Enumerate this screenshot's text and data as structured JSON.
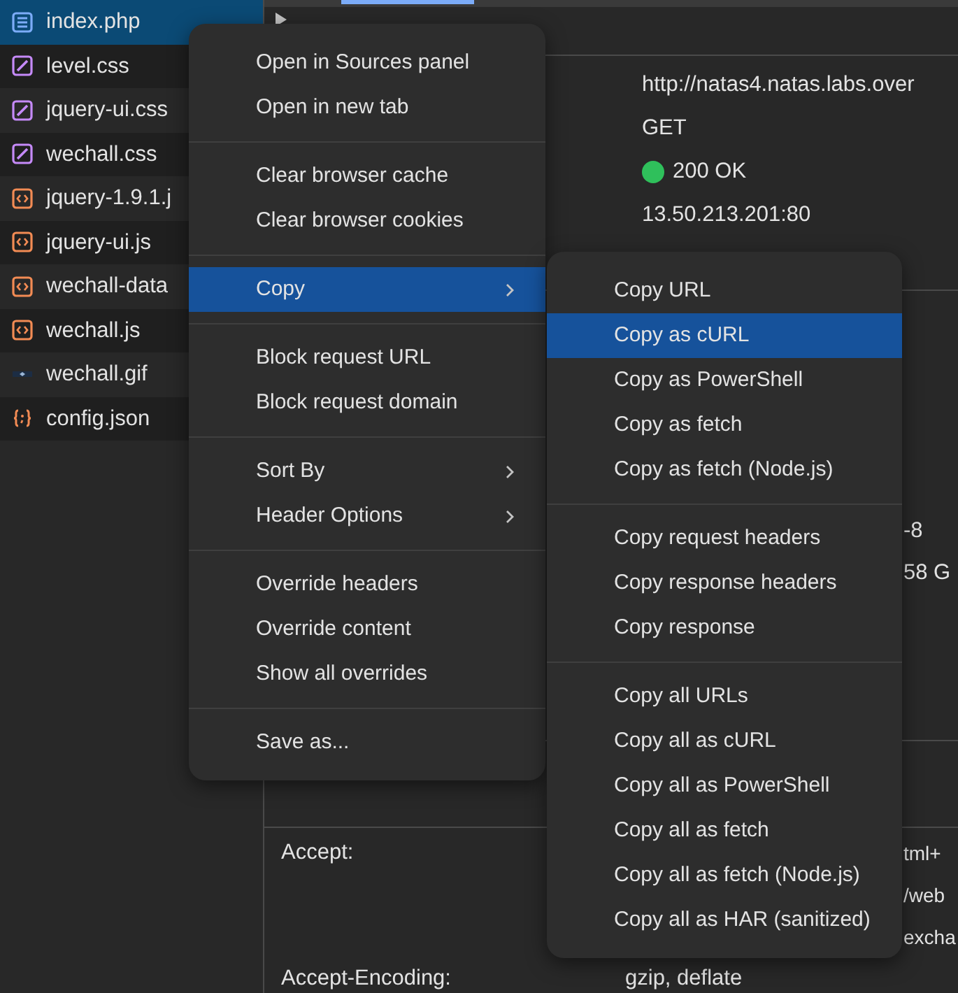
{
  "files": [
    {
      "name": "index.php",
      "kind": "document",
      "selected": true
    },
    {
      "name": "level.css",
      "kind": "stylesheet",
      "selected": false
    },
    {
      "name": "jquery-ui.css",
      "kind": "stylesheet",
      "selected": false
    },
    {
      "name": "wechall.css",
      "kind": "stylesheet",
      "selected": false
    },
    {
      "name": "jquery-1.9.1.j",
      "kind": "script",
      "selected": false
    },
    {
      "name": "jquery-ui.js",
      "kind": "script",
      "selected": false
    },
    {
      "name": "wechall-data",
      "kind": "script",
      "selected": false
    },
    {
      "name": "wechall.js",
      "kind": "script",
      "selected": false
    },
    {
      "name": "wechall.gif",
      "kind": "image",
      "selected": false
    },
    {
      "name": "config.json",
      "kind": "json",
      "selected": false
    }
  ],
  "general": {
    "rows": [
      {
        "value": "http://natas4.natas.labs.over"
      },
      {
        "value": "GET"
      },
      {
        "value": "200 OK",
        "color": "#2fc05b"
      },
      {
        "value": "13.50.213.201:80"
      }
    ]
  },
  "response_headers": {
    "value_tails": [
      "-8",
      "58 G"
    ]
  },
  "request_headers": {
    "rows": [
      {
        "label": "Accept:",
        "value_tails": [
          "tml+",
          "/web",
          "excha"
        ]
      },
      {
        "label": "Accept-Encoding:",
        "value": "gzip, deflate"
      }
    ]
  },
  "context_menu": {
    "groups": [
      [
        {
          "label": "Open in Sources panel",
          "submenu": false,
          "selected": false
        },
        {
          "label": "Open in new tab",
          "submenu": false,
          "selected": false
        }
      ],
      [
        {
          "label": "Clear browser cache",
          "submenu": false,
          "selected": false
        },
        {
          "label": "Clear browser cookies",
          "submenu": false,
          "selected": false
        }
      ],
      [
        {
          "label": "Copy",
          "submenu": true,
          "selected": true
        }
      ],
      [
        {
          "label": "Block request URL",
          "submenu": false,
          "selected": false
        },
        {
          "label": "Block request domain",
          "submenu": false,
          "selected": false
        }
      ],
      [
        {
          "label": "Sort By",
          "submenu": true,
          "selected": false
        },
        {
          "label": "Header Options",
          "submenu": true,
          "selected": false
        }
      ],
      [
        {
          "label": "Override headers",
          "submenu": false,
          "selected": false
        },
        {
          "label": "Override content",
          "submenu": false,
          "selected": false
        },
        {
          "label": "Show all overrides",
          "submenu": false,
          "selected": false
        }
      ],
      [
        {
          "label": "Save as...",
          "submenu": false,
          "selected": false
        }
      ]
    ]
  },
  "copy_submenu": {
    "groups": [
      [
        {
          "label": "Copy URL",
          "selected": false
        },
        {
          "label": "Copy as cURL",
          "selected": true
        },
        {
          "label": "Copy as PowerShell",
          "selected": false
        },
        {
          "label": "Copy as fetch",
          "selected": false
        },
        {
          "label": "Copy as fetch (Node.js)",
          "selected": false
        }
      ],
      [
        {
          "label": "Copy request headers",
          "selected": false
        },
        {
          "label": "Copy response headers",
          "selected": false
        },
        {
          "label": "Copy response",
          "selected": false
        }
      ],
      [
        {
          "label": "Copy all URLs",
          "selected": false
        },
        {
          "label": "Copy all as cURL",
          "selected": false
        },
        {
          "label": "Copy all as PowerShell",
          "selected": false
        },
        {
          "label": "Copy all as fetch",
          "selected": false
        },
        {
          "label": "Copy all as fetch (Node.js)",
          "selected": false
        },
        {
          "label": "Copy all as HAR (sanitized)",
          "selected": false
        }
      ]
    ]
  }
}
